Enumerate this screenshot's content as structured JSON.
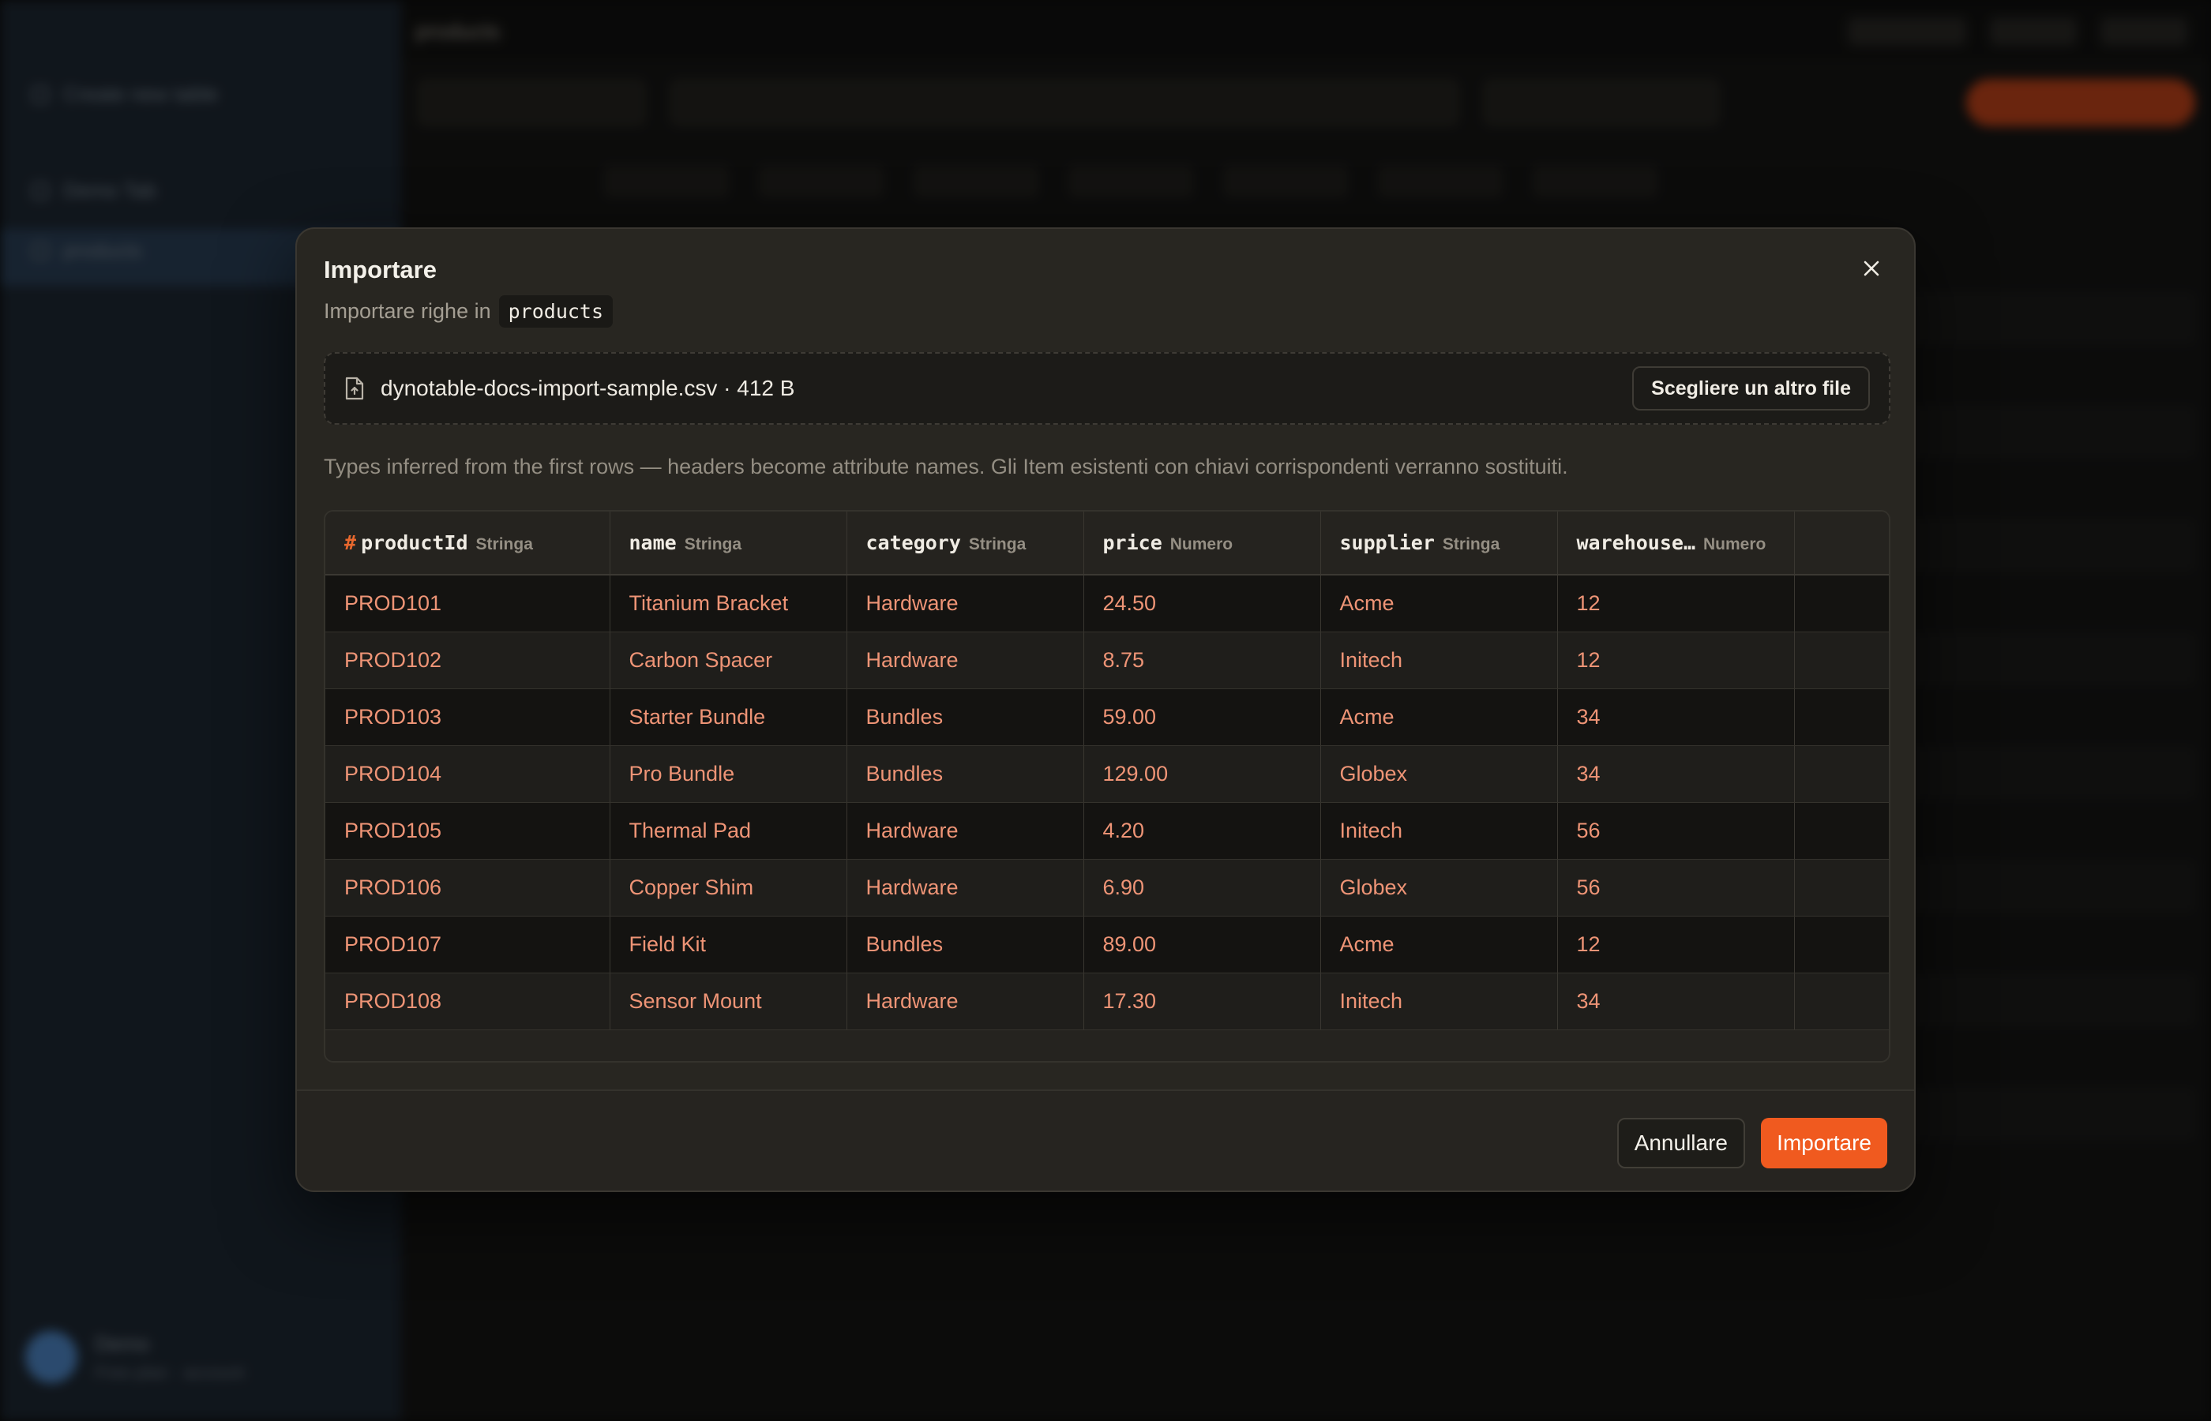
{
  "background": {
    "sidebar": {
      "create_table": "Create new table",
      "demo_tab": "Demo Tab",
      "active_table": "products",
      "user_name": "Demo",
      "user_sub": "Free plan · account"
    },
    "topbar": {
      "title": "products"
    }
  },
  "modal": {
    "title": "Importare",
    "subtitle_prefix": "Importare righe in",
    "table_name": "products",
    "file_label": "dynotable-docs-import-sample.csv · 412 B",
    "choose_file_label": "Scegliere un altro file",
    "note": "Types inferred from the first rows — headers become attribute names. Gli Item esistenti con chiavi corrispondenti verranno sostituiti.",
    "key_marker": "#",
    "columns": [
      {
        "name": "productId",
        "type": "Stringa"
      },
      {
        "name": "name",
        "type": "Stringa"
      },
      {
        "name": "category",
        "type": "Stringa"
      },
      {
        "name": "price",
        "type": "Numero"
      },
      {
        "name": "supplier",
        "type": "Stringa"
      },
      {
        "name": "warehouse…",
        "type": "Numero"
      }
    ],
    "rows": [
      [
        "PROD101",
        "Titanium Bracket",
        "Hardware",
        "24.50",
        "Acme",
        "12"
      ],
      [
        "PROD102",
        "Carbon Spacer",
        "Hardware",
        "8.75",
        "Initech",
        "12"
      ],
      [
        "PROD103",
        "Starter Bundle",
        "Bundles",
        "59.00",
        "Acme",
        "34"
      ],
      [
        "PROD104",
        "Pro Bundle",
        "Bundles",
        "129.00",
        "Globex",
        "34"
      ],
      [
        "PROD105",
        "Thermal Pad",
        "Hardware",
        "4.20",
        "Initech",
        "56"
      ],
      [
        "PROD106",
        "Copper Shim",
        "Hardware",
        "6.90",
        "Globex",
        "56"
      ],
      [
        "PROD107",
        "Field Kit",
        "Bundles",
        "89.00",
        "Acme",
        "12"
      ],
      [
        "PROD108",
        "Sensor Mount",
        "Hardware",
        "17.30",
        "Initech",
        "34"
      ]
    ],
    "cancel_label": "Annullare",
    "import_label": "Importare"
  },
  "colors": {
    "accent": "#f05a1f",
    "cell_text": "#ee9476",
    "key_marker": "#e8682e",
    "modal_bg": "#282621"
  }
}
